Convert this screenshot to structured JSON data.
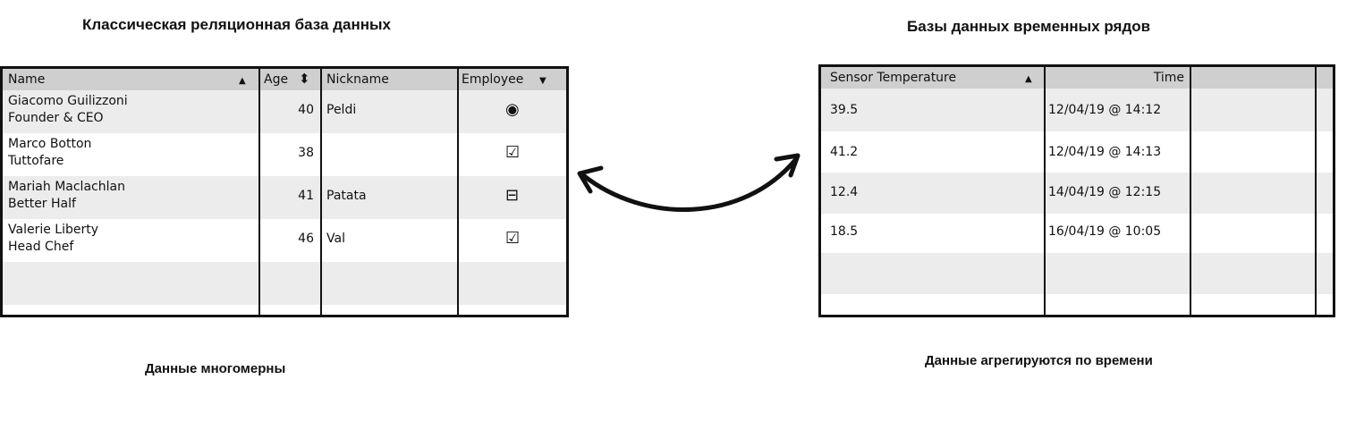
{
  "left": {
    "title": "Классическая реляционная база данных",
    "caption": "Данные многомерны",
    "columns": {
      "name": "Name",
      "age": "Age",
      "nickname": "Nickname",
      "employee": "Employee"
    },
    "rows": [
      {
        "name1": "Giacomo Guilizzoni",
        "name2": "Founder & CEO",
        "age": "40",
        "nickname": "Peldi",
        "employee_icon": "radio-selected-icon"
      },
      {
        "name1": "Marco Botton",
        "name2": "Tuttofare",
        "age": "38",
        "nickname": "",
        "employee_icon": "checkbox-checked-icon"
      },
      {
        "name1": "Mariah Maclachlan",
        "name2": "Better Half",
        "age": "41",
        "nickname": "Patata",
        "employee_icon": "checkbox-indeterminate-icon"
      },
      {
        "name1": "Valerie Liberty",
        "name2": "Head Chef",
        "age": "46",
        "nickname": "Val",
        "employee_icon": "checkbox-checked-icon"
      }
    ]
  },
  "right": {
    "title": "Базы данных временных рядов",
    "caption": "Данные агрегируются по времени",
    "columns": {
      "sensor": "Sensor Temperature",
      "time": "Time"
    },
    "rows": [
      {
        "sensor": "39.5",
        "time": "12/04/19 @ 14:12"
      },
      {
        "sensor": "41.2",
        "time": "12/04/19 @ 14:13"
      },
      {
        "sensor": "12.4",
        "time": "14/04/19 @ 12:15"
      },
      {
        "sensor": "18.5",
        "time": "16/04/19 @ 10:05"
      }
    ]
  },
  "icons": {
    "radio": "◉",
    "checked": "☑",
    "indeterminate": "⊟",
    "sort_up": "▲",
    "sort_both": "⬍",
    "sort_down": "▼"
  }
}
